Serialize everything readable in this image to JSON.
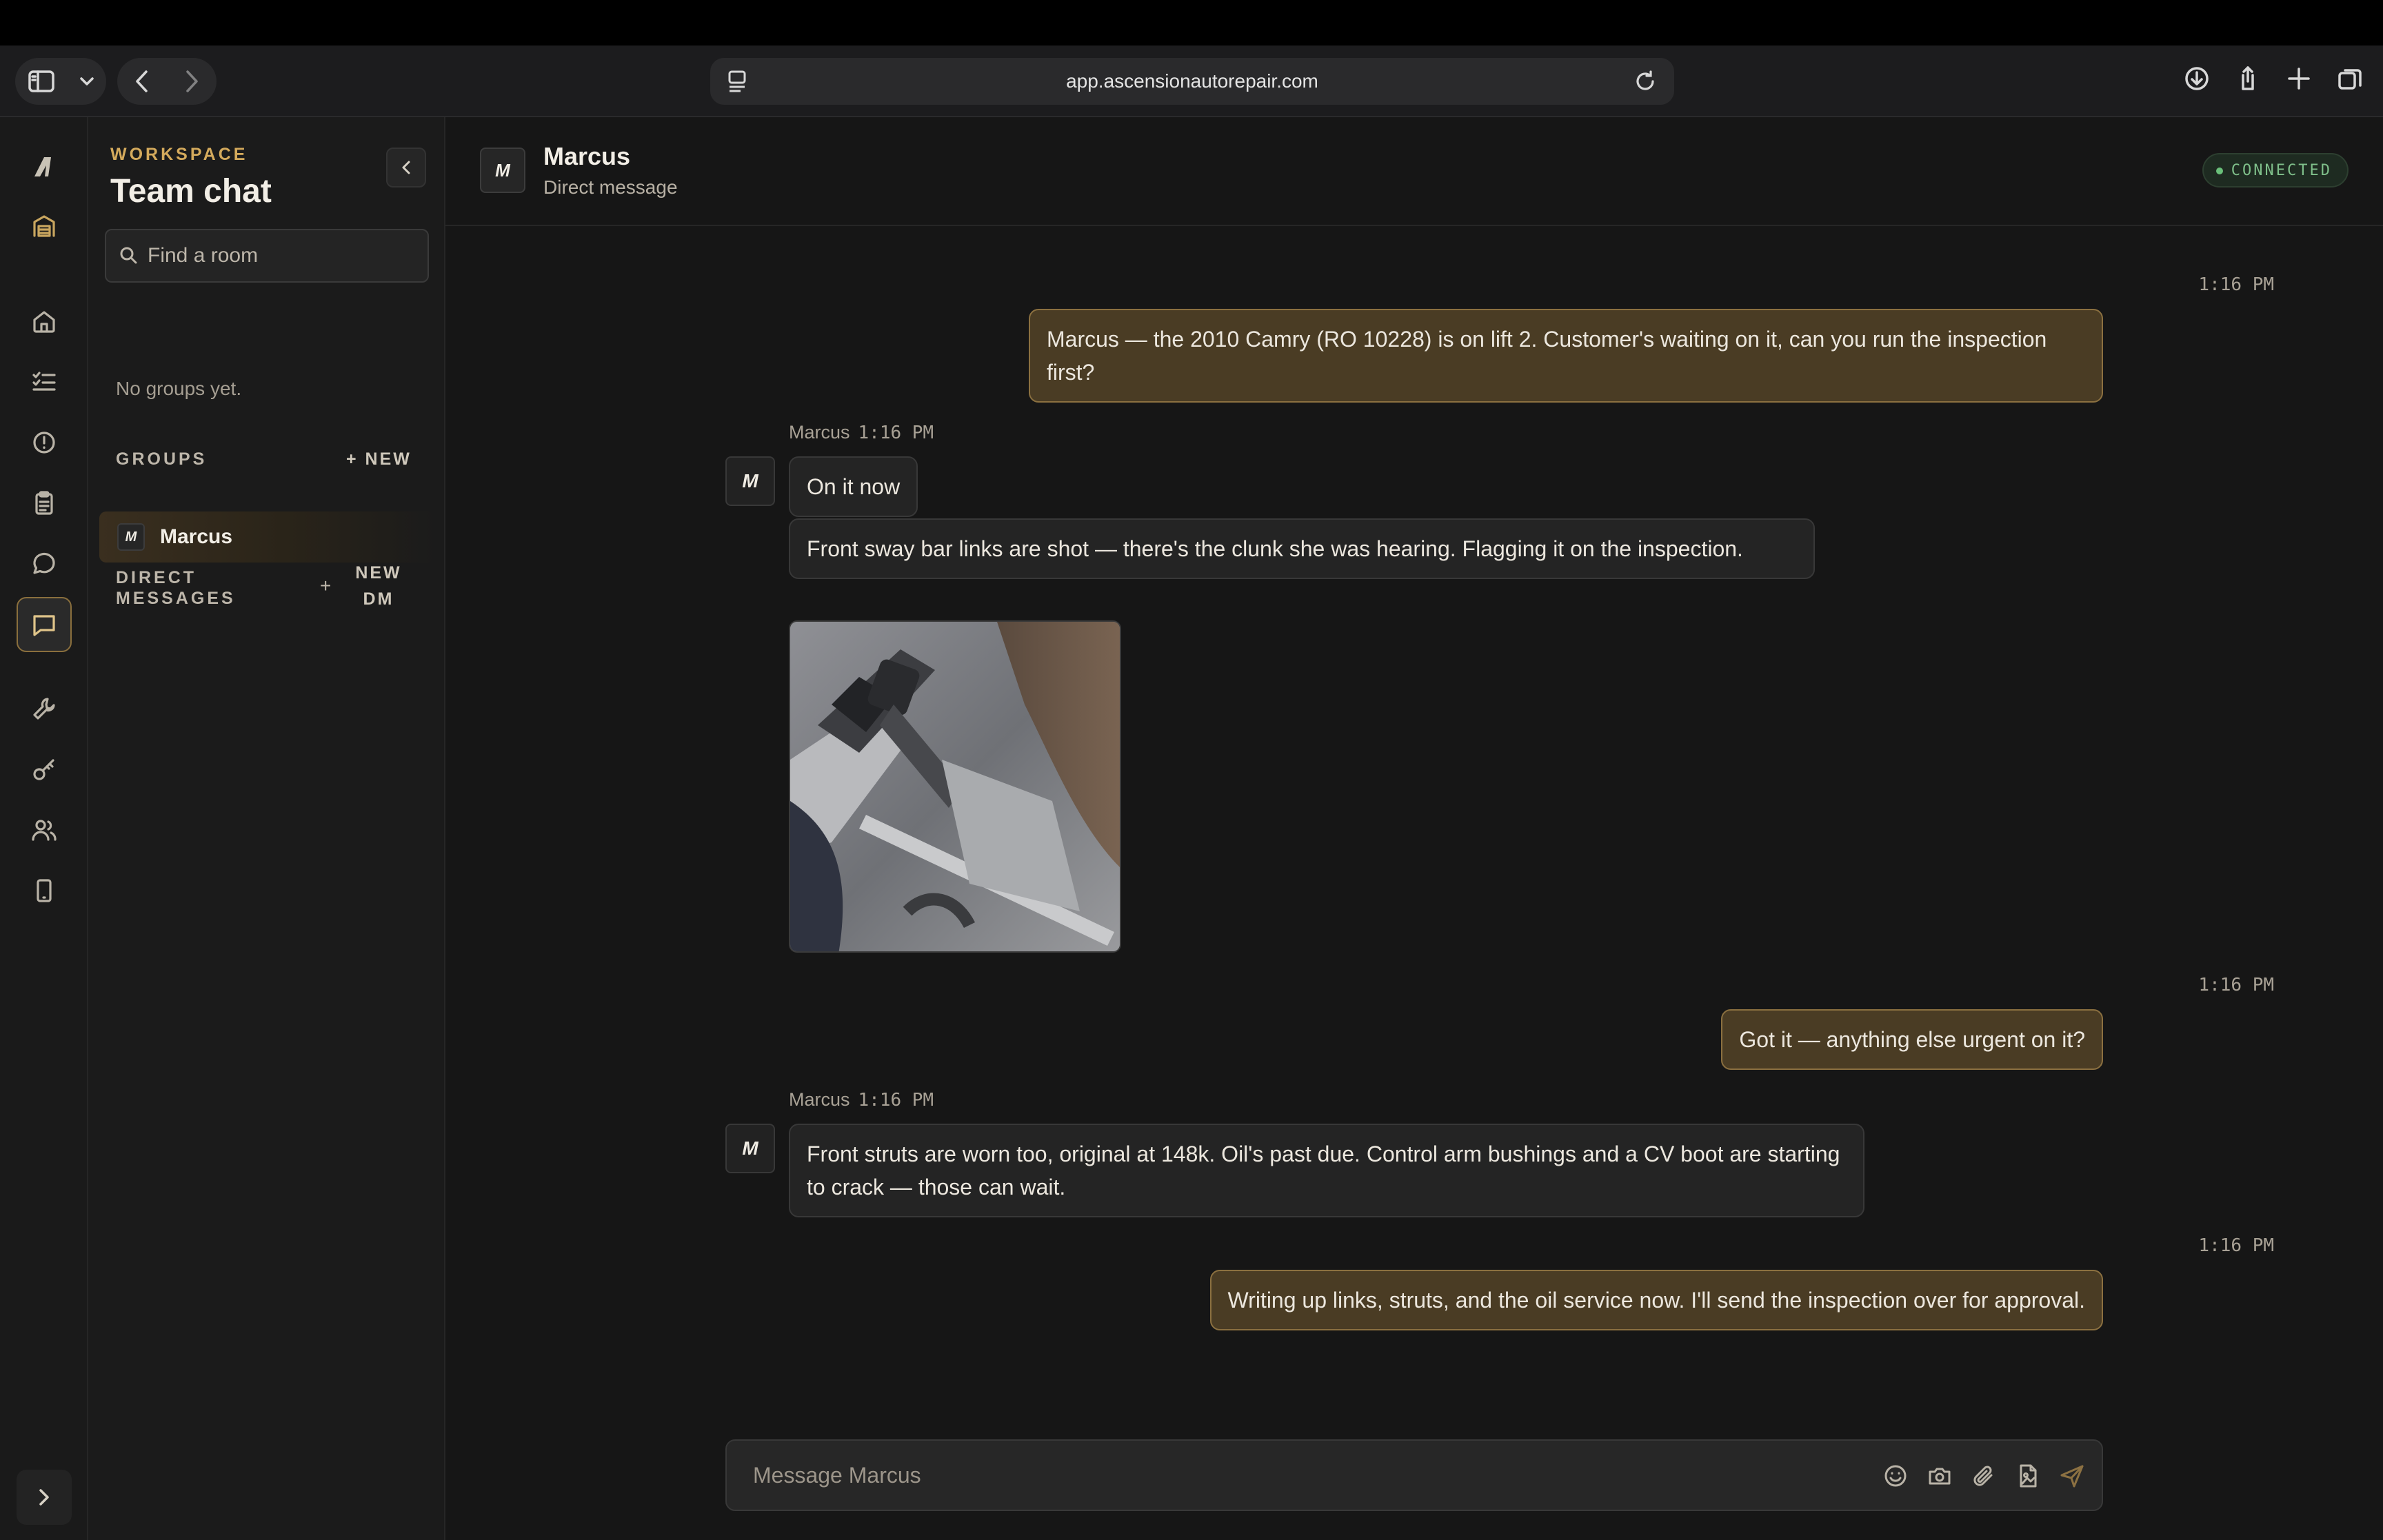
{
  "browser": {
    "url": "app.ascensionautorepair.com"
  },
  "sidebar": {
    "workspace_label": "WORKSPACE",
    "title": "Team chat",
    "search_placeholder": "Find a room",
    "groups_label": "GROUPS",
    "groups_new": "+ NEW",
    "groups_empty": "No groups yet.",
    "dm_label_line1": "DIRECT",
    "dm_label_line2": "MESSAGES",
    "dm_new_plus": "+",
    "dm_new_line1": "NEW",
    "dm_new_line2": "DM",
    "dm_items": [
      {
        "initial": "M",
        "name": "Marcus"
      }
    ]
  },
  "chat": {
    "avatar_initial": "M",
    "name": "Marcus",
    "subtitle": "Direct message",
    "status": "CONNECTED",
    "messages": [
      {
        "direction": "out",
        "time": "1:16 PM",
        "text": "Marcus — the 2010 Camry (RO 10228) is on lift 2. Customer's waiting on it, can you run the inspection first?"
      },
      {
        "direction": "in",
        "sender": "Marcus",
        "time": "1:16 PM",
        "text": "On it now"
      },
      {
        "direction": "in",
        "text": "Front sway bar links are shot — there's the clunk she was hearing. Flagging it on the inspection."
      },
      {
        "direction": "out",
        "time": "1:16 PM",
        "text": "Got it — anything else urgent on it?"
      },
      {
        "direction": "in",
        "sender": "Marcus",
        "time": "1:16 PM",
        "text": "Front struts are worn too, original at 148k. Oil's past due. Control arm bushings and a CV boot are starting to crack — those can wait."
      },
      {
        "direction": "out",
        "time": "1:16 PM",
        "text": "Writing up links, struts, and the oil service now. I'll send the inspection over for approval."
      }
    ],
    "composer_placeholder": "Message Marcus"
  },
  "colors": {
    "accent": "#d4aa5c",
    "outgoing_bubble": "#4a3c24",
    "incoming_bubble": "#242424",
    "connected": "#7fbf8a"
  }
}
